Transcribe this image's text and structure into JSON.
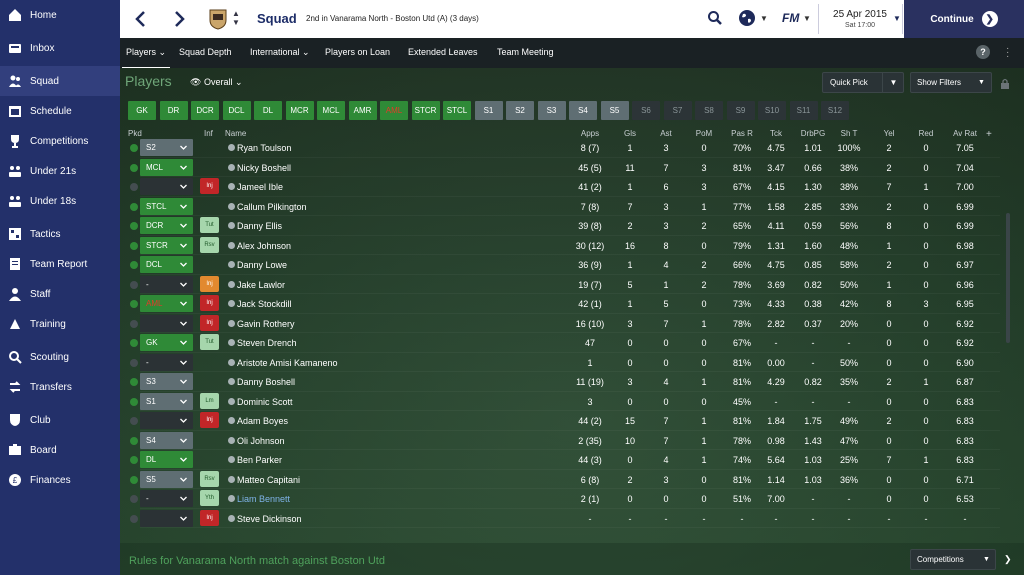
{
  "sidebar": {
    "items": [
      {
        "label": "Home",
        "icon": "home-icon"
      },
      {
        "label": "Inbox",
        "icon": "inbox-icon"
      },
      {
        "label": "Squad",
        "icon": "squad-icon"
      },
      {
        "label": "Schedule",
        "icon": "calendar-icon"
      },
      {
        "label": "Competitions",
        "icon": "trophy-icon"
      },
      {
        "label": "Under 21s",
        "icon": "youth-squad-icon"
      },
      {
        "label": "Under 18s",
        "icon": "youth-squad-icon"
      },
      {
        "label": "Tactics",
        "icon": "tactics-icon"
      },
      {
        "label": "Team Report",
        "icon": "report-icon"
      },
      {
        "label": "Staff",
        "icon": "staff-icon"
      },
      {
        "label": "Training",
        "icon": "training-icon"
      },
      {
        "label": "Scouting",
        "icon": "scouting-icon"
      },
      {
        "label": "Transfers",
        "icon": "transfers-icon"
      },
      {
        "label": "Club",
        "icon": "club-icon"
      },
      {
        "label": "Board",
        "icon": "board-icon"
      },
      {
        "label": "Finances",
        "icon": "finances-icon"
      }
    ],
    "active": "Squad"
  },
  "header": {
    "title": "Squad",
    "subtitle": "2nd in Vanarama North - Boston Utd (A) (3 days)",
    "logo": "FM",
    "date": "25 Apr 2015",
    "time": "Sat 17:00",
    "continue_label": "Continue"
  },
  "submenu": {
    "items": [
      "Players",
      "Squad Depth",
      "International",
      "Players on Loan",
      "Extended Leaves",
      "Team Meeting"
    ],
    "help": "?"
  },
  "panel": {
    "title": "Players",
    "view": "Overall",
    "quick_pick": "Quick Pick",
    "show_filters": "Show Filters"
  },
  "position_buttons": [
    "GK",
    "DR",
    "DCR",
    "DCL",
    "DL",
    "MCR",
    "MCL",
    "AMR",
    "AML",
    "STCR",
    "STCL",
    "S1",
    "S2",
    "S3",
    "S4",
    "S5",
    "S6",
    "S7",
    "S8",
    "S9",
    "S10",
    "S11",
    "S12"
  ],
  "columns": [
    "Pkd",
    "Inf",
    "Name",
    "Apps",
    "Gls",
    "Ast",
    "PoM",
    "Pas R",
    "Tck",
    "DrbPG",
    "Sh T",
    "Yel",
    "Red",
    "Av Rat"
  ],
  "players": [
    {
      "pkd": "S2",
      "inf": "",
      "name": "Ryan Toulson",
      "apps": "8 (7)",
      "gls": "1",
      "ast": "3",
      "pom": "0",
      "pasr": "70%",
      "tck": "4.75",
      "drb": "1.01",
      "sht": "100%",
      "yel": "2",
      "red": "0",
      "avr": "7.05"
    },
    {
      "pkd": "MCL",
      "inf": "",
      "name": "Nicky Boshell",
      "apps": "45 (5)",
      "gls": "11",
      "ast": "7",
      "pom": "3",
      "pasr": "81%",
      "tck": "3.47",
      "drb": "0.66",
      "sht": "38%",
      "yel": "2",
      "red": "0",
      "avr": "7.04"
    },
    {
      "pkd": "",
      "inf": "Inj",
      "name": "Jameel Ible",
      "apps": "41 (2)",
      "gls": "1",
      "ast": "6",
      "pom": "3",
      "pasr": "67%",
      "tck": "4.15",
      "drb": "1.30",
      "sht": "38%",
      "yel": "7",
      "red": "1",
      "avr": "7.00"
    },
    {
      "pkd": "STCL",
      "inf": "",
      "name": "Callum Pilkington",
      "apps": "7 (8)",
      "gls": "7",
      "ast": "3",
      "pom": "1",
      "pasr": "77%",
      "tck": "1.58",
      "drb": "2.85",
      "sht": "33%",
      "yel": "2",
      "red": "0",
      "avr": "6.99"
    },
    {
      "pkd": "DCR",
      "inf": "Tut",
      "name": "Danny Ellis",
      "apps": "39 (8)",
      "gls": "2",
      "ast": "3",
      "pom": "2",
      "pasr": "65%",
      "tck": "4.11",
      "drb": "0.59",
      "sht": "56%",
      "yel": "8",
      "red": "0",
      "avr": "6.99"
    },
    {
      "pkd": "STCR",
      "inf": "Rsv",
      "name": "Alex Johnson",
      "apps": "30 (12)",
      "gls": "16",
      "ast": "8",
      "pom": "0",
      "pasr": "79%",
      "tck": "1.31",
      "drb": "1.60",
      "sht": "48%",
      "yel": "1",
      "red": "0",
      "avr": "6.98"
    },
    {
      "pkd": "DCL",
      "inf": "",
      "name": "Danny Lowe",
      "apps": "36 (9)",
      "gls": "1",
      "ast": "4",
      "pom": "2",
      "pasr": "66%",
      "tck": "4.75",
      "drb": "0.85",
      "sht": "58%",
      "yel": "2",
      "red": "0",
      "avr": "6.97"
    },
    {
      "pkd": "-",
      "inf": "Inj",
      "name": "Jake Lawlor",
      "apps": "19 (7)",
      "gls": "5",
      "ast": "1",
      "pom": "2",
      "pasr": "78%",
      "tck": "3.69",
      "drb": "0.82",
      "sht": "50%",
      "yel": "1",
      "red": "0",
      "avr": "6.96"
    },
    {
      "pkd": "AML",
      "inf": "Inj",
      "name": "Jack Stockdill",
      "apps": "42 (1)",
      "gls": "1",
      "ast": "5",
      "pom": "0",
      "pasr": "73%",
      "tck": "4.33",
      "drb": "0.38",
      "sht": "42%",
      "yel": "8",
      "red": "3",
      "avr": "6.95"
    },
    {
      "pkd": "",
      "inf": "Inj",
      "name": "Gavin Rothery",
      "apps": "16 (10)",
      "gls": "3",
      "ast": "7",
      "pom": "1",
      "pasr": "78%",
      "tck": "2.82",
      "drb": "0.37",
      "sht": "20%",
      "yel": "0",
      "red": "0",
      "avr": "6.92"
    },
    {
      "pkd": "GK",
      "inf": "Tut",
      "name": "Steven Drench",
      "apps": "47",
      "gls": "0",
      "ast": "0",
      "pom": "0",
      "pasr": "67%",
      "tck": "-",
      "drb": "-",
      "sht": "-",
      "yel": "0",
      "red": "0",
      "avr": "6.92"
    },
    {
      "pkd": "-",
      "inf": "",
      "name": "Aristote Amisi Kamaneno",
      "apps": "1",
      "gls": "0",
      "ast": "0",
      "pom": "0",
      "pasr": "81%",
      "tck": "0.00",
      "drb": "-",
      "sht": "50%",
      "yel": "0",
      "red": "0",
      "avr": "6.90"
    },
    {
      "pkd": "S3",
      "inf": "",
      "name": "Danny Boshell",
      "apps": "11 (19)",
      "gls": "3",
      "ast": "4",
      "pom": "1",
      "pasr": "81%",
      "tck": "4.29",
      "drb": "0.82",
      "sht": "35%",
      "yel": "2",
      "red": "1",
      "avr": "6.87"
    },
    {
      "pkd": "S1",
      "inf": "Lm",
      "name": "Dominic Scott",
      "apps": "3",
      "gls": "0",
      "ast": "0",
      "pom": "0",
      "pasr": "45%",
      "tck": "-",
      "drb": "-",
      "sht": "-",
      "yel": "0",
      "red": "0",
      "avr": "6.83"
    },
    {
      "pkd": "",
      "inf": "Inj",
      "name": "Adam Boyes",
      "apps": "44 (2)",
      "gls": "15",
      "ast": "7",
      "pom": "1",
      "pasr": "81%",
      "tck": "1.84",
      "drb": "1.75",
      "sht": "49%",
      "yel": "2",
      "red": "0",
      "avr": "6.83"
    },
    {
      "pkd": "S4",
      "inf": "",
      "name": "Oli Johnson",
      "apps": "2 (35)",
      "gls": "10",
      "ast": "7",
      "pom": "1",
      "pasr": "78%",
      "tck": "0.98",
      "drb": "1.43",
      "sht": "47%",
      "yel": "0",
      "red": "0",
      "avr": "6.83"
    },
    {
      "pkd": "DL",
      "inf": "",
      "name": "Ben Parker",
      "apps": "44 (3)",
      "gls": "0",
      "ast": "4",
      "pom": "1",
      "pasr": "74%",
      "tck": "5.64",
      "drb": "1.03",
      "sht": "25%",
      "yel": "7",
      "red": "1",
      "avr": "6.83"
    },
    {
      "pkd": "S5",
      "inf": "Rsv",
      "name": "Matteo Capitani",
      "apps": "6 (8)",
      "gls": "2",
      "ast": "3",
      "pom": "0",
      "pasr": "81%",
      "tck": "1.14",
      "drb": "1.03",
      "sht": "36%",
      "yel": "0",
      "red": "0",
      "avr": "6.71"
    },
    {
      "pkd": "-",
      "inf": "Yth",
      "name": "Liam Bennett",
      "apps": "2 (1)",
      "gls": "0",
      "ast": "0",
      "pom": "0",
      "pasr": "51%",
      "tck": "7.00",
      "drb": "-",
      "sht": "-",
      "yel": "0",
      "red": "0",
      "avr": "6.53"
    },
    {
      "pkd": "",
      "inf": "Inj",
      "name": "Steve Dickinson",
      "apps": "-",
      "gls": "-",
      "ast": "-",
      "pom": "-",
      "pasr": "-",
      "tck": "-",
      "drb": "-",
      "sht": "-",
      "yel": "-",
      "red": "-",
      "avr": "-"
    }
  ],
  "footer": {
    "rules": "Rules for Vanarama North match against Boston Utd",
    "competitions": "Competitions"
  },
  "colors": {
    "sidebar": "#23306a",
    "accent_green": "#2f8a37",
    "injury": "#c12628"
  }
}
